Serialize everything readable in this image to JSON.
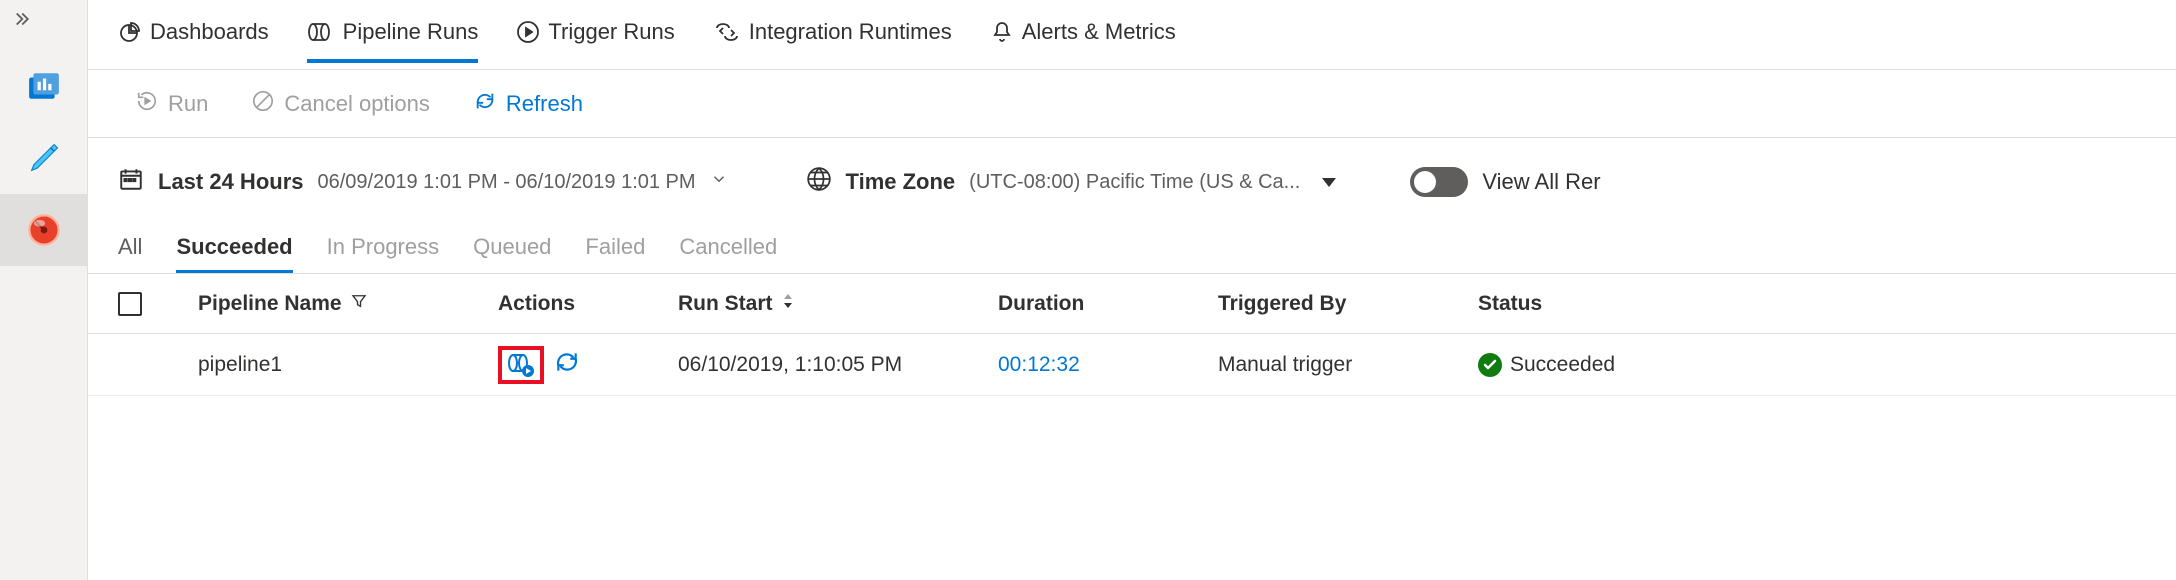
{
  "left_rail": {
    "expand_tooltip": "Expand"
  },
  "topnav": {
    "dashboards": "Dashboards",
    "pipeline_runs": "Pipeline Runs",
    "trigger_runs": "Trigger Runs",
    "integration_runtimes": "Integration Runtimes",
    "alerts_metrics": "Alerts & Metrics"
  },
  "toolbar": {
    "run": "Run",
    "cancel_options": "Cancel options",
    "refresh": "Refresh"
  },
  "filters": {
    "time_range_label": "Last 24 Hours",
    "time_range_value": "06/09/2019 1:01 PM - 06/10/2019 1:01 PM",
    "timezone_label": "Time Zone",
    "timezone_value": "(UTC-08:00) Pacific Time (US & Ca...",
    "view_all_label": "View All Rer"
  },
  "status_tabs": {
    "all": "All",
    "succeeded": "Succeeded",
    "in_progress": "In Progress",
    "queued": "Queued",
    "failed": "Failed",
    "cancelled": "Cancelled"
  },
  "table": {
    "headers": {
      "pipeline_name": "Pipeline Name",
      "actions": "Actions",
      "run_start": "Run Start",
      "duration": "Duration",
      "triggered_by": "Triggered By",
      "status": "Status"
    },
    "rows": [
      {
        "pipeline_name": "pipeline1",
        "run_start": "06/10/2019, 1:10:05 PM",
        "duration": "00:12:32",
        "triggered_by": "Manual trigger",
        "status": "Succeeded"
      }
    ]
  }
}
